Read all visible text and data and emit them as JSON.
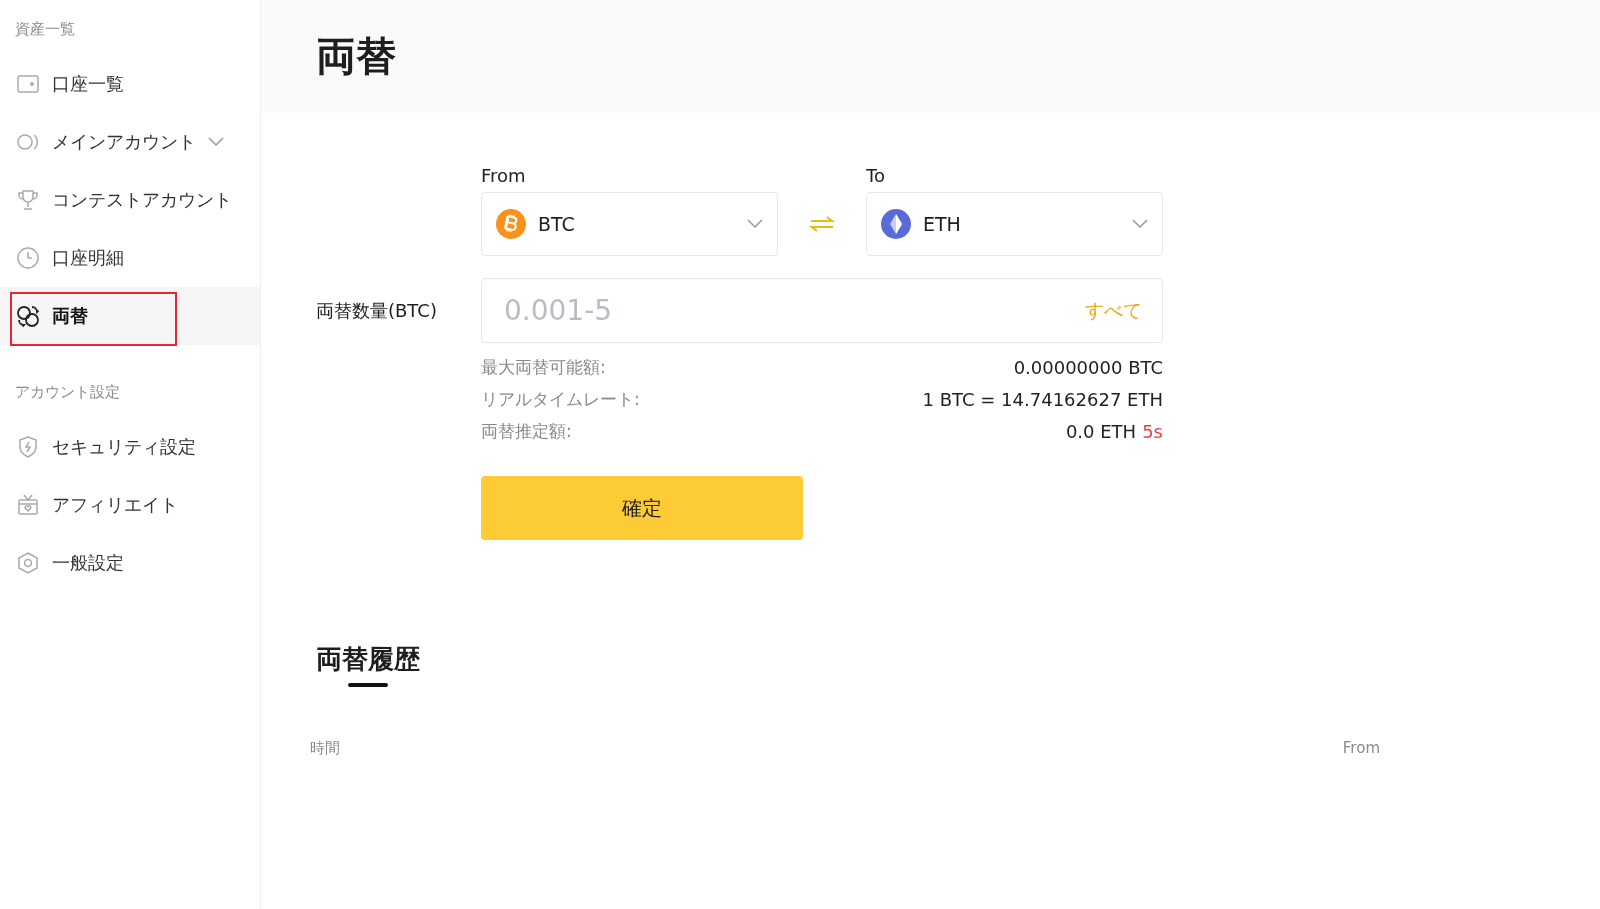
{
  "sidebar": {
    "sections": [
      {
        "label": "資産一覧",
        "items": [
          {
            "label": "口座一覧",
            "kind": "wallet",
            "selected": false,
            "annotated": false,
            "expandable": false
          },
          {
            "label": "メインアカウント",
            "kind": "toggle",
            "selected": false,
            "annotated": false,
            "expandable": true
          },
          {
            "label": "コンテストアカウント",
            "kind": "trophy",
            "selected": false,
            "annotated": false,
            "expandable": false
          },
          {
            "label": "口座明細",
            "kind": "clock",
            "selected": false,
            "annotated": false,
            "expandable": false
          },
          {
            "label": "両替",
            "kind": "exchange",
            "selected": true,
            "annotated": true,
            "expandable": false
          }
        ]
      },
      {
        "label": "アカウント設定",
        "items": [
          {
            "label": "セキュリティ設定",
            "kind": "shield",
            "selected": false,
            "annotated": false,
            "expandable": false
          },
          {
            "label": "アフィリエイト",
            "kind": "gift",
            "selected": false,
            "annotated": false,
            "expandable": false
          },
          {
            "label": "一般設定",
            "kind": "hexagon",
            "selected": false,
            "annotated": false,
            "expandable": false
          }
        ]
      }
    ]
  },
  "page": {
    "title": "両替"
  },
  "form": {
    "from": {
      "label": "From",
      "coin": "BTC",
      "kind": "btc"
    },
    "to": {
      "label": "To",
      "coin": "ETH",
      "kind": "eth"
    },
    "amount": {
      "label": "両替数量(BTC)",
      "placeholder": "0.001-5",
      "all_link": "すべて"
    },
    "info": [
      {
        "label": "最大両替可能額:",
        "value": "0.00000000 BTC"
      },
      {
        "label": "リアルタイムレート:",
        "value": "1 BTC = 14.74162627 ETH"
      },
      {
        "label": "両替推定額:",
        "value": "0.0 ETH",
        "countdown": "5s"
      }
    ],
    "submit": "確定"
  },
  "history": {
    "title": "両替履歴",
    "columns": [
      "時間",
      "From"
    ]
  }
}
